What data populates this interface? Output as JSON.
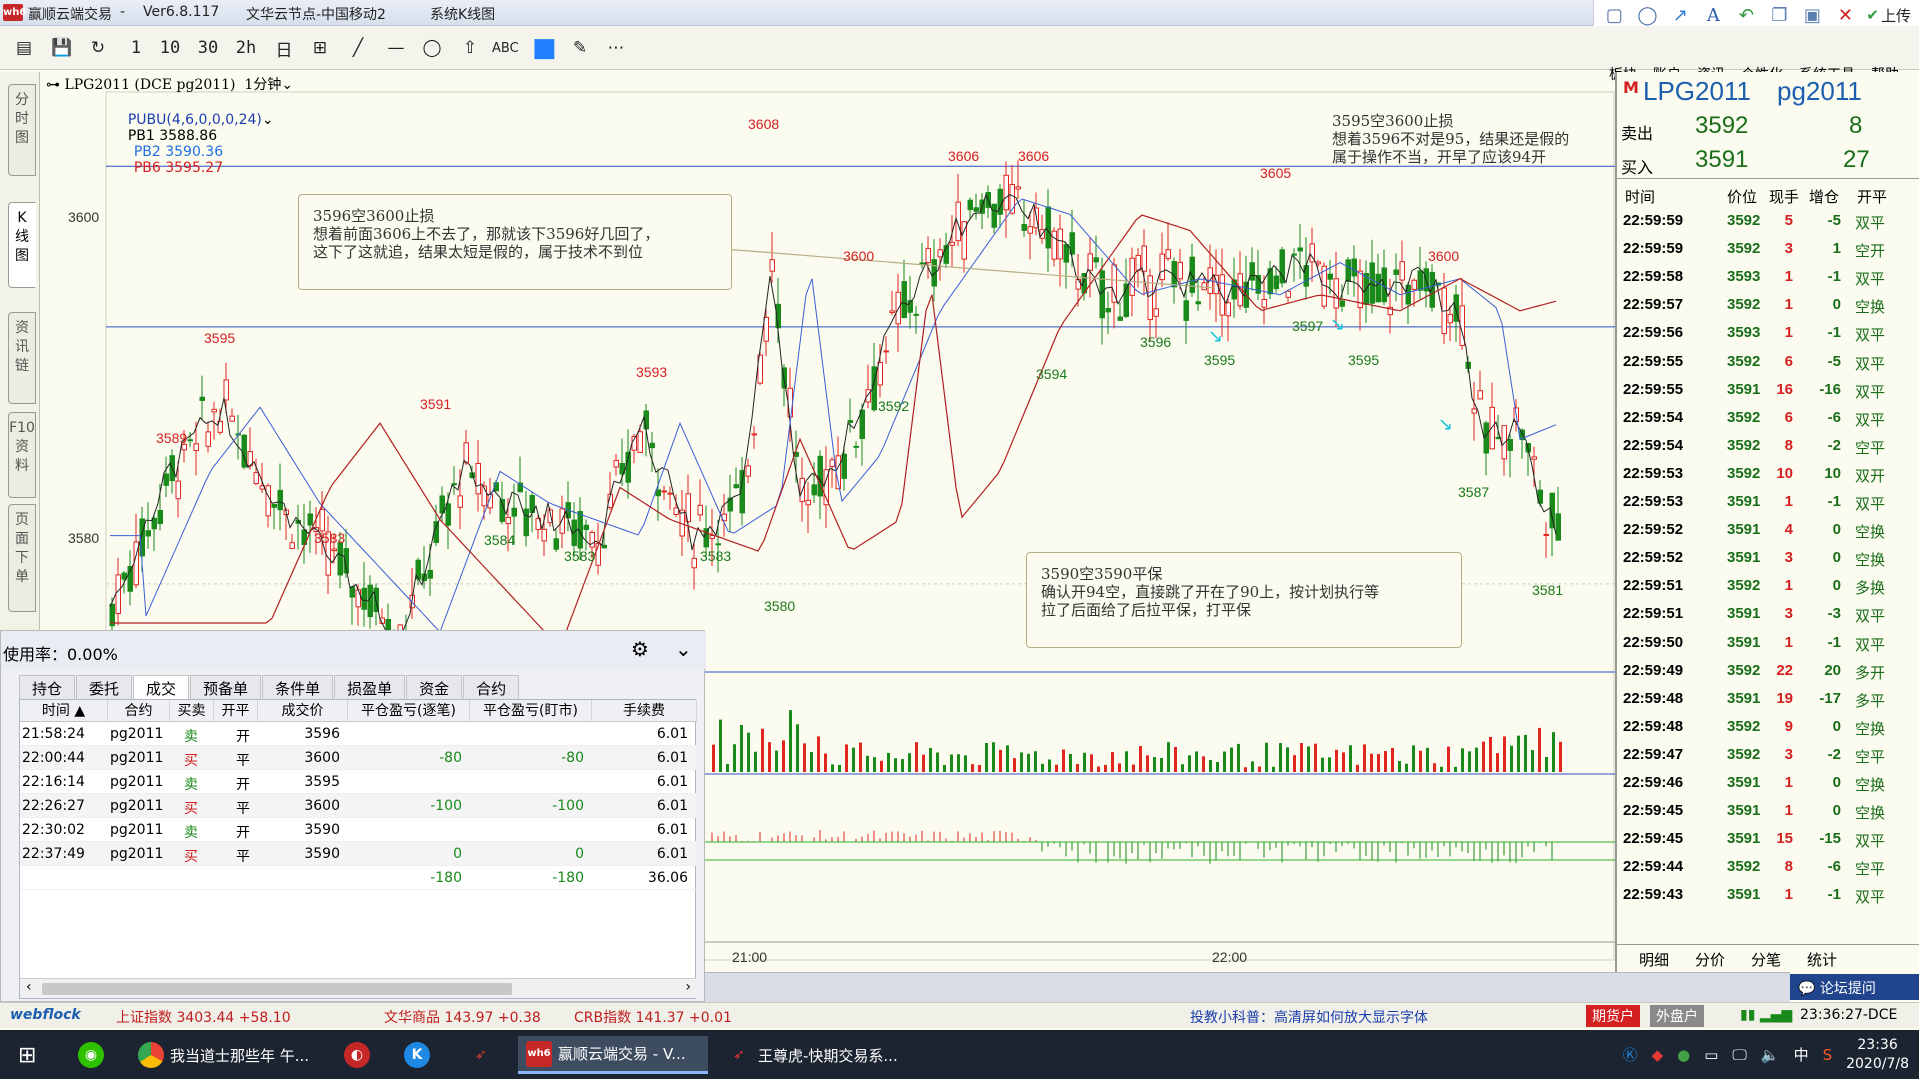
{
  "app": {
    "title": "赢顺云端交易",
    "version": "Ver6.8.117",
    "node": "文华云节点-中国移动2",
    "view": "系统K线图",
    "logo_text": "wh6"
  },
  "window_controls": [
    "square-icon",
    "circle-icon",
    "arrow-icon",
    "text-icon",
    "undo-icon",
    "copy-icon",
    "save-icon",
    "close-icon",
    "upload-icon"
  ],
  "upload_label": "上传",
  "toolbar": {
    "items": [
      "单",
      "💾",
      "↻",
      "1",
      "10",
      "30",
      "2h",
      "日",
      "⊞",
      "╱",
      "—",
      "◯",
      "⇧",
      "ABC",
      "■",
      "✎",
      "⋯"
    ]
  },
  "menu": [
    "板块",
    "账户",
    "资讯",
    "个性化",
    "系统工具",
    "帮助"
  ],
  "left_tabs": [
    "分\n时\n图",
    "K\n线\n图",
    "资\n讯\n链",
    "F10\n资\n料",
    "页\n面\n下\n单"
  ],
  "chart": {
    "symbol_header": "LPG2011 (DCE pg2011)  1分钟",
    "indicator": "PUBU(4,6,0,0,0,24)",
    "pb1_label": "PB1 3588.86",
    "pb2_label": "PB2 3590.36",
    "pb6_label": "PB6 3595.27",
    "axis_3600": "3600",
    "axis_3580": "3580",
    "time_2100": "21:00",
    "time_2200": "22:00",
    "price_labels": {
      "red": [
        "3608",
        "3606",
        "3606",
        "3605",
        "3600",
        "3600",
        "3595",
        "3593",
        "3591",
        "3589",
        "3583"
      ],
      "green": [
        "3596",
        "3595",
        "3597",
        "3595",
        "3594",
        "3592",
        "3584",
        "3583",
        "3583",
        "3580",
        "3587",
        "3581"
      ]
    },
    "annotations": {
      "a1": "3596空3600止损\n想着前面3606上不去了，那就该下3596好几回了，\n这下了这就追，结果太短是假的，属于技术不到位",
      "a2": "3595空3600止损\n想着3596不对是95，结果还是假的\n属于操作不当，开早了应该94开",
      "a3": "3590空3590平保\n确认开94空，直接跳了开在了90上，按计划执行等\n拉了后面给了后拉平保，打平保"
    },
    "chart_data": {
      "type": "candlestick",
      "y_range": [
        3577,
        3610
      ],
      "series": [
        {
          "name": "PB1",
          "value": 3588.86
        },
        {
          "name": "PB2",
          "value": 3590.36
        },
        {
          "name": "PB6",
          "value": 3595.27
        }
      ],
      "lows_marked": [
        3580,
        3581,
        3583,
        3584
      ],
      "highs_marked": [
        3608,
        3606,
        3605,
        3600
      ]
    }
  },
  "quote": {
    "symbol": "LPG2011",
    "code": "pg2011",
    "m_badge": "M",
    "sell_label": "卖出",
    "sell_price": "3592",
    "sell_vol": "8",
    "buy_label": "买入",
    "buy_price": "3591",
    "buy_vol": "27",
    "headers": [
      "时间",
      "价位",
      "现手",
      "增仓",
      "开平"
    ],
    "ticks": [
      [
        "22:59:59",
        "3592",
        "5",
        "-5",
        "双平"
      ],
      [
        "22:59:59",
        "3592",
        "3",
        "1",
        "空开"
      ],
      [
        "22:59:58",
        "3593",
        "1",
        "-1",
        "双平"
      ],
      [
        "22:59:57",
        "3592",
        "1",
        "0",
        "空换"
      ],
      [
        "22:59:56",
        "3593",
        "1",
        "-1",
        "双平"
      ],
      [
        "22:59:55",
        "3592",
        "6",
        "-5",
        "双平"
      ],
      [
        "22:59:55",
        "3591",
        "16",
        "-16",
        "双平"
      ],
      [
        "22:59:54",
        "3592",
        "6",
        "-6",
        "双平"
      ],
      [
        "22:59:54",
        "3592",
        "8",
        "-2",
        "空平"
      ],
      [
        "22:59:53",
        "3592",
        "10",
        "10",
        "双开"
      ],
      [
        "22:59:53",
        "3591",
        "1",
        "-1",
        "双平"
      ],
      [
        "22:59:52",
        "3591",
        "4",
        "0",
        "空换"
      ],
      [
        "22:59:52",
        "3591",
        "3",
        "0",
        "空换"
      ],
      [
        "22:59:51",
        "3592",
        "1",
        "0",
        "多换"
      ],
      [
        "22:59:51",
        "3591",
        "3",
        "-3",
        "双平"
      ],
      [
        "22:59:50",
        "3591",
        "1",
        "-1",
        "双平"
      ],
      [
        "22:59:49",
        "3592",
        "22",
        "20",
        "多开"
      ],
      [
        "22:59:48",
        "3591",
        "19",
        "-17",
        "多平"
      ],
      [
        "22:59:48",
        "3592",
        "9",
        "0",
        "空换"
      ],
      [
        "22:59:47",
        "3592",
        "3",
        "-2",
        "空平"
      ],
      [
        "22:59:46",
        "3591",
        "1",
        "0",
        "空换"
      ],
      [
        "22:59:45",
        "3591",
        "1",
        "0",
        "空换"
      ],
      [
        "22:59:45",
        "3591",
        "15",
        "-15",
        "双平"
      ],
      [
        "22:59:44",
        "3592",
        "8",
        "-6",
        "空平"
      ],
      [
        "22:59:43",
        "3591",
        "1",
        "-1",
        "双平"
      ]
    ],
    "bottom_tabs": [
      "明细",
      "分价",
      "分笔",
      "统计"
    ]
  },
  "trade": {
    "usage": "使用率：0.00%",
    "tabs": [
      "持仓",
      "委托",
      "成交",
      "预备单",
      "条件单",
      "损盈单",
      "资金",
      "合约"
    ],
    "headers": [
      "时间",
      "合约",
      "买卖",
      "开平",
      "成交价",
      "平仓盈亏(逐笔)",
      "平仓盈亏(盯市)",
      "手续费"
    ],
    "rows": [
      [
        "21:58:24",
        "pg2011",
        "卖",
        "开",
        "3596",
        "",
        "",
        "6.01"
      ],
      [
        "22:00:44",
        "pg2011",
        "买",
        "平",
        "3600",
        "-80",
        "-80",
        "6.01"
      ],
      [
        "22:16:14",
        "pg2011",
        "卖",
        "开",
        "3595",
        "",
        "",
        "6.01"
      ],
      [
        "22:26:27",
        "pg2011",
        "买",
        "平",
        "3600",
        "-100",
        "-100",
        "6.01"
      ],
      [
        "22:30:02",
        "pg2011",
        "卖",
        "开",
        "3590",
        "",
        "",
        "6.01"
      ],
      [
        "22:37:49",
        "pg2011",
        "买",
        "平",
        "3590",
        "0",
        "0",
        "6.01"
      ]
    ],
    "total": [
      "",
      "",
      "",
      "",
      "",
      "-180",
      "-180",
      "36.06"
    ]
  },
  "status": {
    "brand": "webflock",
    "ticker1": "上证指数  3403.44  +58.10",
    "ticker2": "文华商品  143.97  +0.38",
    "ticker3": "CRB指数  141.37  +0.01",
    "tip": "投教小科普：高清屏如何放大显示字体",
    "btn_futures": "期货户",
    "btn_foreign": "外盘户",
    "forum": "论坛提问",
    "time": "23:36:27-DCE"
  },
  "taskbar": {
    "items": [
      {
        "name": "wechat",
        "label": ""
      },
      {
        "name": "chrome",
        "label": "我当道士那些年 午..."
      },
      {
        "name": "app-red",
        "label": ""
      },
      {
        "name": "app-k",
        "label": ""
      },
      {
        "name": "app-arrow",
        "label": ""
      },
      {
        "name": "wh6",
        "label": "赢顺云端交易 - V..."
      },
      {
        "name": "kuaiqi",
        "label": "王尊虎-快期交易系..."
      }
    ],
    "ime": "中",
    "clock_time": "23:36",
    "clock_date": "2020/7/8"
  },
  "colors": {
    "up": "#e0261e",
    "down": "#1a8a1a",
    "bg": "#fbfbf0",
    "accent_blue": "#1c5fae"
  }
}
